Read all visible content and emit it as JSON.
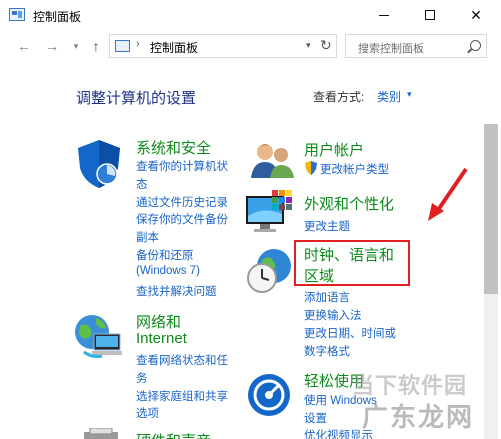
{
  "window": {
    "title": "控制面板",
    "minimize_glyph": "—",
    "maximize_glyph": "☐",
    "close_glyph": "✕"
  },
  "nav": {
    "back_glyph": "←",
    "forward_glyph": "→",
    "recent_glyph": "▾",
    "up_glyph": "↑",
    "address_sep": "›",
    "address_text": "控制面板",
    "address_drop": "▾",
    "refresh_glyph": "↻",
    "search_placeholder": "搜索控制面板"
  },
  "header": {
    "title": "调整计算机的设置",
    "view_by_label": "查看方式:",
    "view_by_value": "类别",
    "view_by_arrow": "▾"
  },
  "left_column": [
    {
      "heading": "系统和安全",
      "icon": "shield-icon",
      "links": [
        "查看你的计算机状态",
        "通过文件历史记录保存你的文件备份副本",
        "备份和还原(Windows 7)",
        "查找并解决问题"
      ]
    },
    {
      "heading": "网络和 Internet",
      "icon": "network-globe-icon",
      "links": [
        "查看网络状态和任务",
        "选择家庭组和共享选项"
      ]
    },
    {
      "heading": "硬件和声音",
      "icon": "printer-icon",
      "links": []
    }
  ],
  "right_column": [
    {
      "heading": "用户帐户",
      "icon": "users-icon",
      "links": [
        "更改帐户类型"
      ]
    },
    {
      "heading": "外观和个性化",
      "icon": "monitor-icon",
      "links": [
        "更改主题"
      ]
    },
    {
      "heading": "时钟、语言和区域",
      "icon": "clock-globe-icon",
      "links": [
        "添加语言",
        "更换输入法",
        "更改日期、时间或数字格式"
      ]
    },
    {
      "heading": "轻松使用",
      "icon": "ease-of-access-icon",
      "links": [
        "使用 Windows 建议的设置",
        "优化视频显示"
      ]
    }
  ],
  "left_lines": {
    "sys_1": "查看你的计算机状",
    "sys_2": "态",
    "sys_3": "通过文件历史记录",
    "sys_4": "保存你的文件备份",
    "sys_5": "副本",
    "sys_6": "备份和还原",
    "sys_7": "(Windows 7)",
    "sys_8": "查找并解决问题",
    "net_h1": "网络和",
    "net_h2": "Internet",
    "net_1": "查看网络状态和任",
    "net_2": "务",
    "net_3": "选择家庭组和共享",
    "net_4": "选项",
    "hw_h": "硬件和声音"
  },
  "right_lines": {
    "clk_h1": "时钟、语言和",
    "clk_h2": "区域",
    "clk_1": "添加语言",
    "clk_2": "更换输入法",
    "clk_3": "更改日期、时间或",
    "clk_4": "数字格式",
    "ease_h": "轻松使用",
    "ease_1": "使用 Windows",
    "ease_2": "设置",
    "ease_3": "优化视频显示"
  },
  "watermark": {
    "line1": "当下软件园",
    "line2": "广东龙网"
  },
  "colors": {
    "heading_green": "#0e8a1c",
    "link_blue": "#1a64c8",
    "title_navy": "#1e3287",
    "highlight_red": "#e02020"
  }
}
